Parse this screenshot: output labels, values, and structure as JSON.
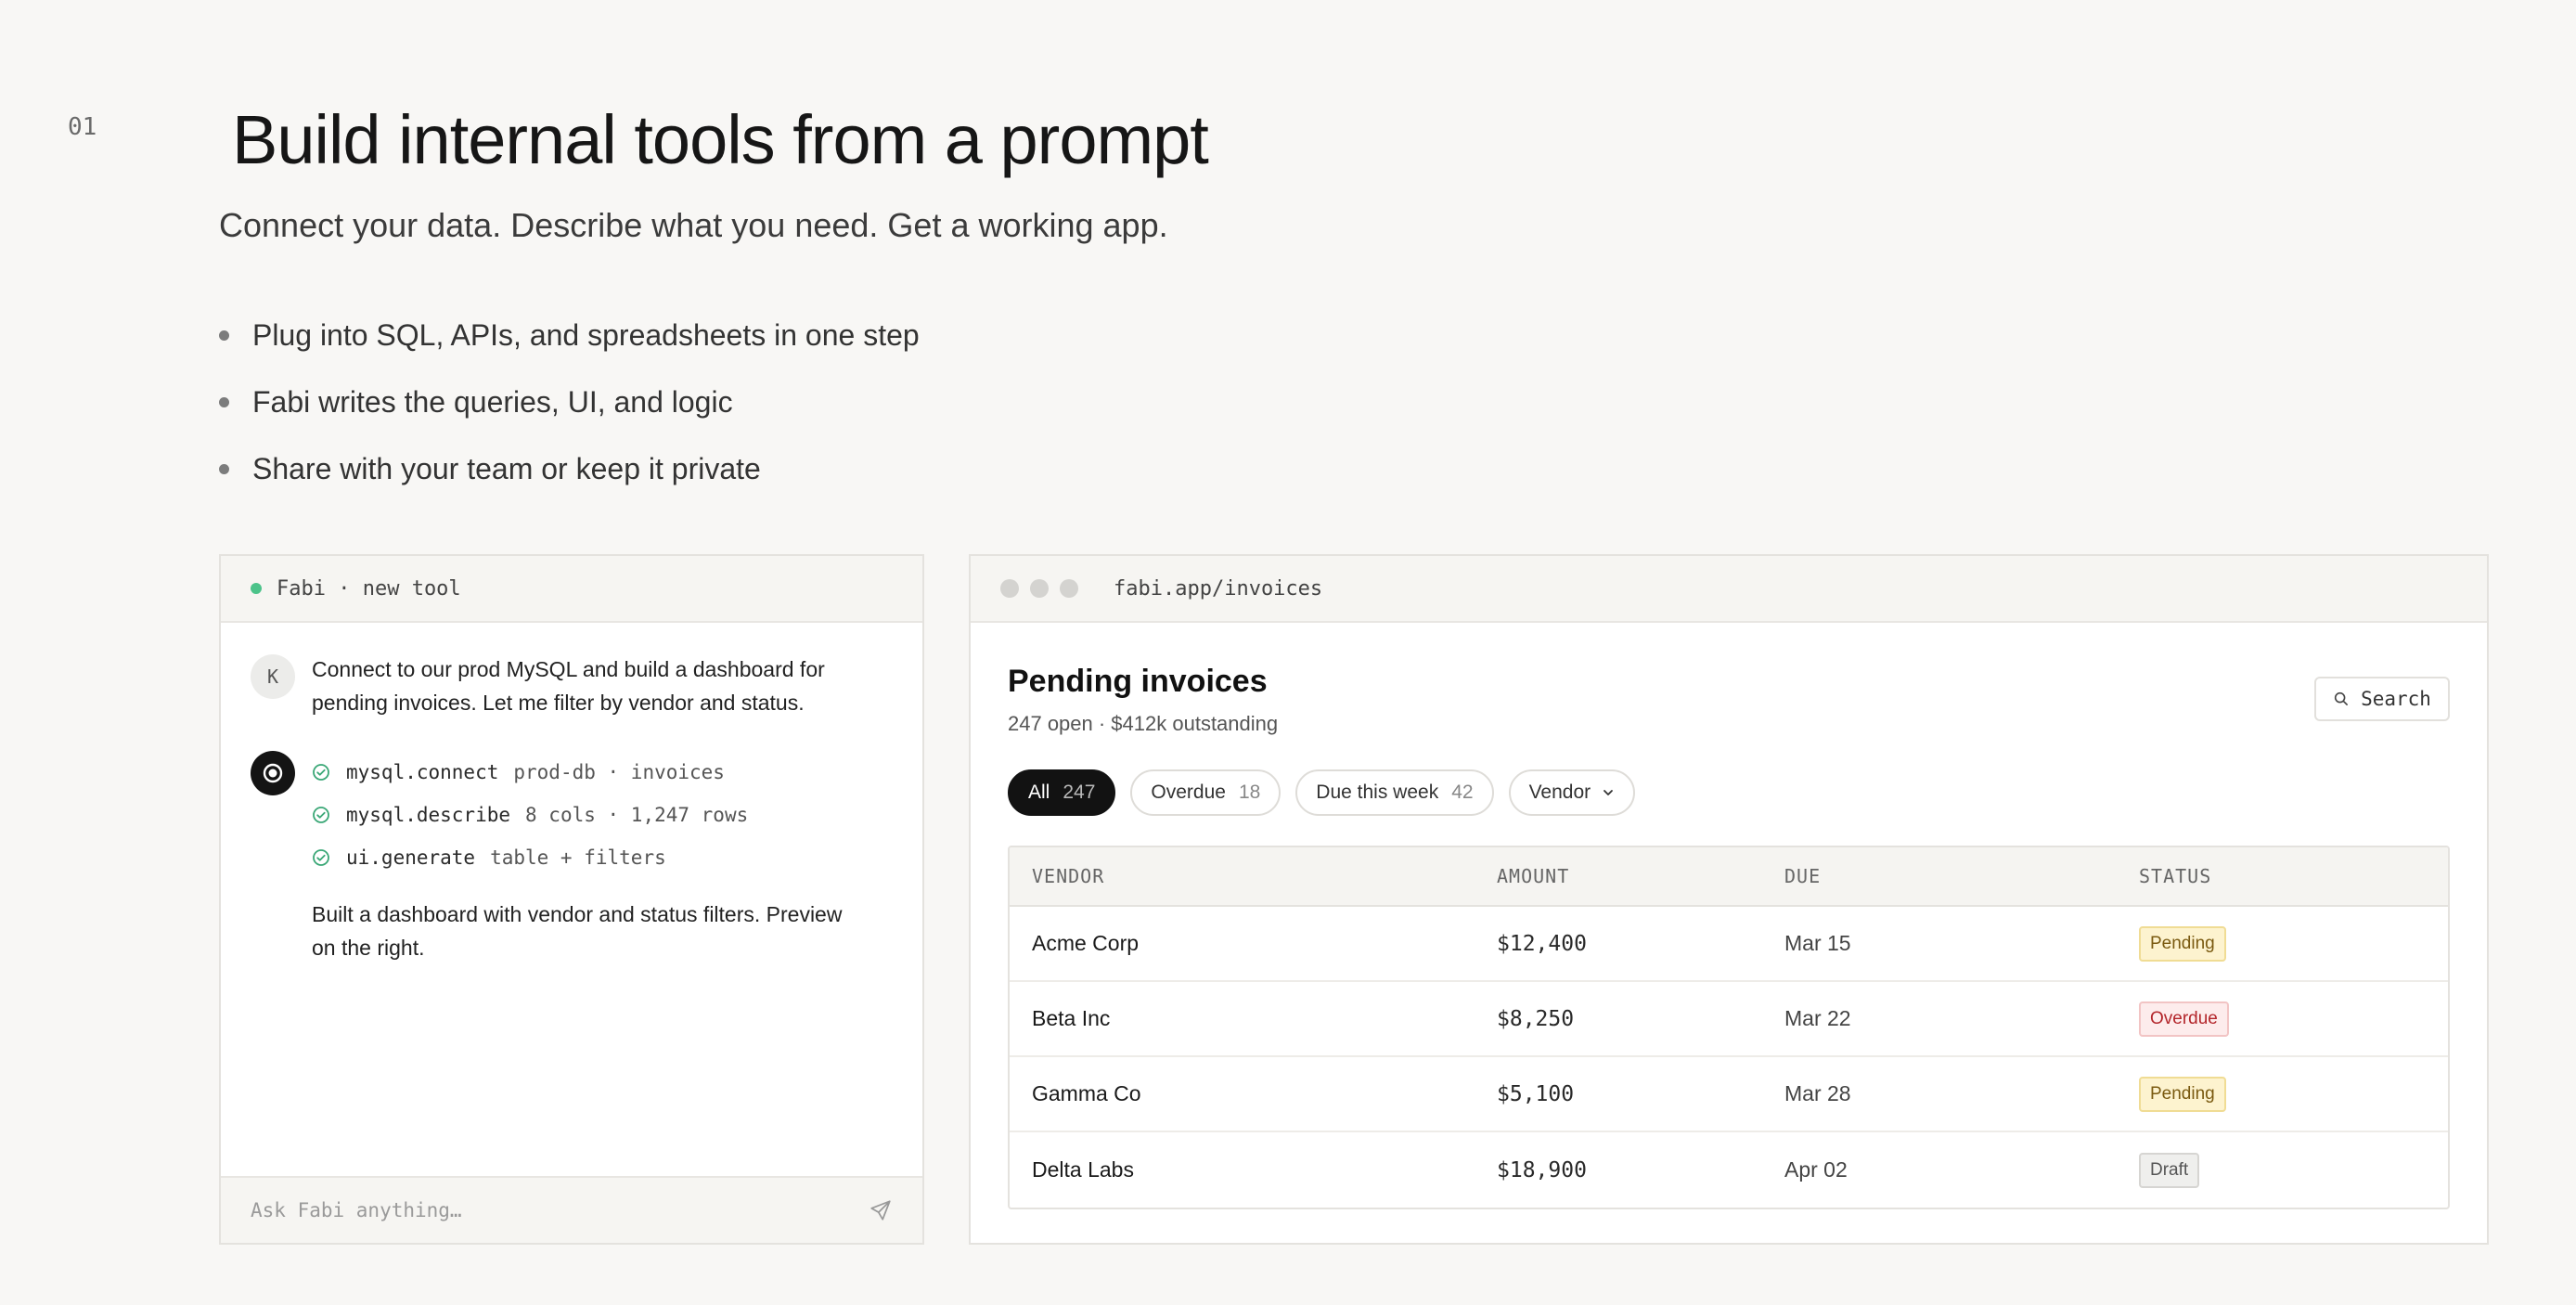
{
  "section": {
    "number": "01"
  },
  "hero": {
    "title": "Build internal tools from a prompt",
    "subtitle": "Connect your data. Describe what you need. Get a working app.",
    "bullets": [
      "Plug into SQL, APIs, and spreadsheets in one step",
      "Fabi writes the queries, UI, and logic",
      "Share with your team or keep it private"
    ]
  },
  "chat": {
    "header": "Fabi · new tool",
    "status_color": "#4cc38a",
    "user_avatar": "K",
    "user_message": "Connect to our prod MySQL and build a dashboard for pending invoices. Let me filter by vendor and status.",
    "steps": [
      {
        "cmd": "mysql.connect",
        "arg": "prod-db · invoices"
      },
      {
        "cmd": "mysql.describe",
        "arg": "8 cols · 1,247 rows"
      },
      {
        "cmd": "ui.generate",
        "arg": "table + filters"
      }
    ],
    "bot_reply": "Built a dashboard with vendor and status filters. Preview on the right.",
    "input_placeholder": "Ask Fabi anything…"
  },
  "browser": {
    "url": "fabi.app/invoices",
    "title": "Pending invoices",
    "subtitle": "247 open · $412k outstanding",
    "search_label": "Search",
    "filters": [
      {
        "label": "All",
        "count": "247",
        "active": true
      },
      {
        "label": "Overdue",
        "count": "18"
      },
      {
        "label": "Due this week",
        "count": "42"
      },
      {
        "label": "Vendor",
        "count": ""
      }
    ],
    "columns": [
      "VENDOR",
      "AMOUNT",
      "DUE",
      "STATUS"
    ],
    "rows": [
      {
        "vendor": "Acme Corp",
        "amount": "$12,400",
        "due": "Mar 15",
        "status": "Pending"
      },
      {
        "vendor": "Beta Inc",
        "amount": "$8,250",
        "due": "Mar 22",
        "status": "Overdue"
      },
      {
        "vendor": "Gamma Co",
        "amount": "$5,100",
        "due": "Mar 28",
        "status": "Pending"
      },
      {
        "vendor": "Delta Labs",
        "amount": "$18,900",
        "due": "Apr 02",
        "status": "Draft"
      }
    ]
  }
}
